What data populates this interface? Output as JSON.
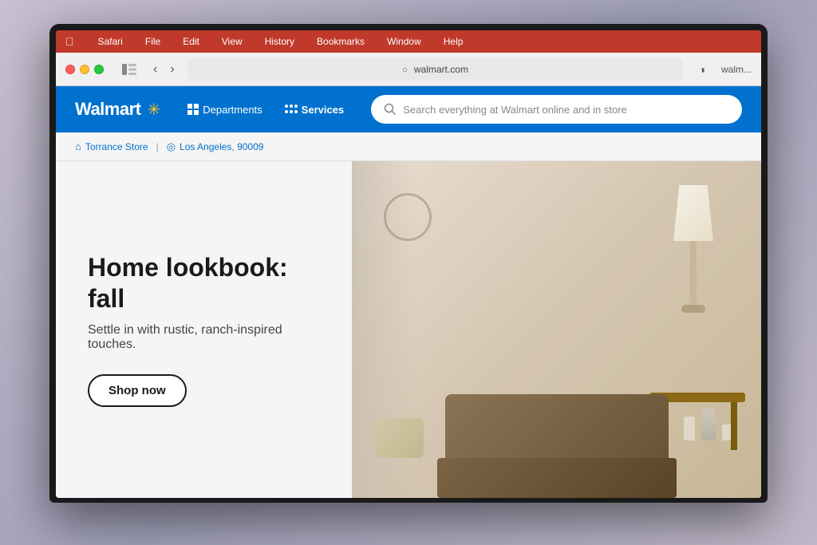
{
  "monitor": {
    "background": "#b0a8b8"
  },
  "macos_menubar": {
    "apple_symbol": "",
    "menu_items": [
      "Safari",
      "File",
      "Edit",
      "View",
      "History",
      "Bookmarks",
      "Window",
      "Help"
    ]
  },
  "safari_toolbar": {
    "traffic_lights": [
      "red",
      "yellow",
      "green"
    ],
    "back_button": "‹",
    "forward_button": "›",
    "address": "walmart.com",
    "tab_icon": "◑",
    "user_label": "walm..."
  },
  "walmart_header": {
    "logo_text": "Walmart",
    "spark_symbol": "✳",
    "nav_items": [
      {
        "label": "Departments",
        "icon": "grid",
        "active": false
      },
      {
        "label": "Services",
        "icon": "dots",
        "active": true
      }
    ],
    "search_placeholder": "Search everything at Walmart online and in store"
  },
  "location_bar": {
    "store_icon": "⌂",
    "store_name": "Torrance Store",
    "separator": "|",
    "location_icon": "◎",
    "location_name": "Los Angeles, 90009"
  },
  "hero_section": {
    "title": "Home lookbook: fall",
    "subtitle": "Settle in with rustic, ranch-inspired touches.",
    "cta_label": "Shop now"
  }
}
